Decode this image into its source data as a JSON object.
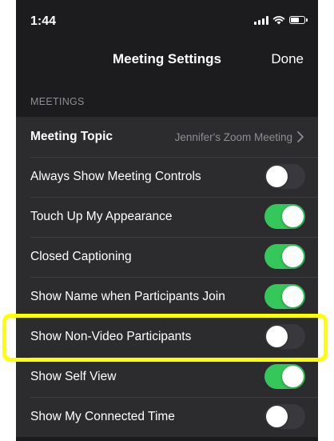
{
  "status_bar": {
    "time": "1:44"
  },
  "nav": {
    "title": "Meeting Settings",
    "done_label": "Done"
  },
  "section": {
    "header": "MEETINGS"
  },
  "rows": [
    {
      "label": "Meeting Topic",
      "value": "Jennifer's Zoom Meeting",
      "type": "link"
    },
    {
      "label": "Always Show Meeting Controls",
      "type": "toggle",
      "on": false
    },
    {
      "label": "Touch Up My Appearance",
      "type": "toggle",
      "on": true
    },
    {
      "label": "Closed Captioning",
      "type": "toggle",
      "on": true
    },
    {
      "label": "Show Name when Participants Join",
      "type": "toggle",
      "on": true
    },
    {
      "label": "Show Non-Video Participants",
      "type": "toggle",
      "on": false,
      "highlighted": true
    },
    {
      "label": "Show Self View",
      "type": "toggle",
      "on": true
    },
    {
      "label": "Show My Connected Time",
      "type": "toggle",
      "on": false
    }
  ],
  "colors": {
    "background": "#1c1c1e",
    "cell": "#2c2c2e",
    "toggle_on": "#34c759",
    "toggle_off": "#39393d",
    "secondary_text": "#8e8e93",
    "highlight": "#ffff00"
  }
}
